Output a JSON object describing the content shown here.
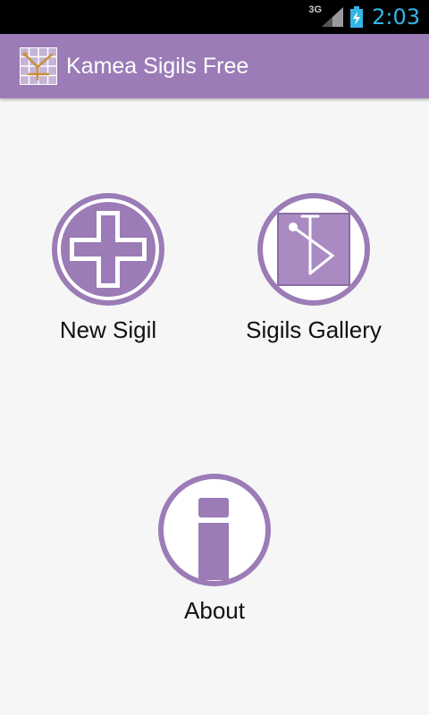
{
  "status_bar": {
    "network": "3G",
    "time": "2:03",
    "colors": {
      "background": "#000000",
      "clock": "#33b5e5"
    }
  },
  "action_bar": {
    "title": "Kamea Sigils Free",
    "icon": "kamea-grid-icon",
    "color": "#9b7cb6"
  },
  "menu": {
    "new_sigil": {
      "label": "New Sigil",
      "icon": "plus-cross-icon"
    },
    "gallery": {
      "label": "Sigils Gallery",
      "icon": "sigil-gallery-icon"
    },
    "about": {
      "label": "About",
      "icon": "info-icon"
    }
  },
  "colors": {
    "accent": "#9b7cb6",
    "background": "#f6f6f6"
  }
}
